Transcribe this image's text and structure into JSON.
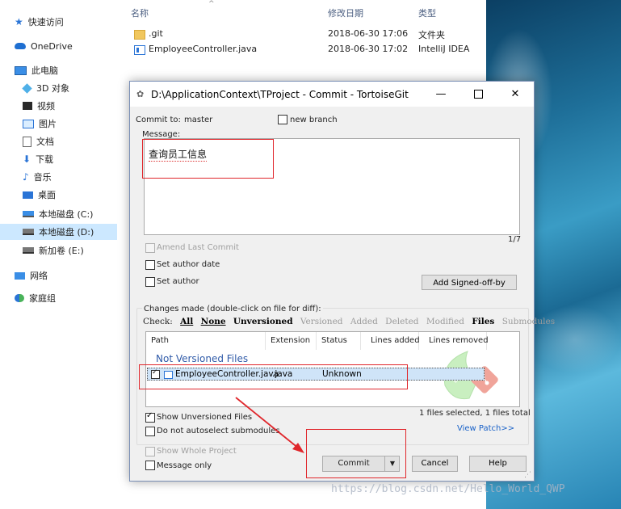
{
  "explorer": {
    "nav": {
      "quick_access": "快速访问",
      "onedrive": "OneDrive",
      "this_pc": "此电脑",
      "objects_3d": "3D 对象",
      "videos": "视频",
      "pictures": "图片",
      "documents": "文档",
      "downloads": "下载",
      "music": "音乐",
      "desktop": "桌面",
      "drive_c": "本地磁盘 (C:)",
      "drive_d": "本地磁盘 (D:)",
      "drive_e": "新加卷 (E:)",
      "network": "网络",
      "homegroup": "家庭组"
    },
    "columns": {
      "name": "名称",
      "modified": "修改日期",
      "type": "类型"
    },
    "files": [
      {
        "name": ".git",
        "modified": "2018-06-30 17:06",
        "type": "文件夹"
      },
      {
        "name": "EmployeeController.java",
        "modified": "2018-06-30 17:02",
        "type": "IntelliJ IDEA"
      }
    ]
  },
  "dialog": {
    "title": "D:\\ApplicationContext\\TProject - Commit - TortoiseGit",
    "commit_to_label": "Commit to:",
    "branch": "master",
    "new_branch_label": "new branch",
    "message_label": "Message:",
    "message_text": "查询员工信息",
    "counter": "1/7",
    "amend_label": "Amend Last Commit",
    "set_author_date_label": "Set author date",
    "set_author_label": "Set author",
    "signed_off_button": "Add Signed-off-by",
    "changes_label": "Changes made (double-click on file for diff):",
    "check_label": "Check:",
    "filters": {
      "all": "All",
      "none": "None",
      "unversioned": "Unversioned",
      "versioned": "Versioned",
      "added": "Added",
      "deleted": "Deleted",
      "modified": "Modified",
      "files": "Files",
      "submodules": "Submodules"
    },
    "list_columns": {
      "path": "Path",
      "extension": "Extension",
      "status": "Status",
      "lines_added": "Lines added",
      "lines_removed": "Lines removed"
    },
    "group_header": "Not Versioned Files",
    "list_rows": [
      {
        "path": "EmployeeController.java",
        "extension": ".java",
        "status": "Unknown",
        "checked": true
      }
    ],
    "show_unversioned_label": "Show Unversioned Files",
    "no_autoselect_label": "Do not autoselect submodules",
    "selection_info": "1 files selected, 1 files total",
    "view_patch": "View Patch>>",
    "show_whole_project_label": "Show Whole Project",
    "message_only_label": "Message only",
    "commit_button": "Commit",
    "cancel_button": "Cancel",
    "help_button": "Help"
  },
  "watermark": "https://blog.csdn.net/Hello_World_QWP",
  "colors": {
    "annotation": "#e0262b",
    "selection": "#cfe4f8",
    "link": "#1a62c8",
    "group_header": "#2f5aa8"
  }
}
